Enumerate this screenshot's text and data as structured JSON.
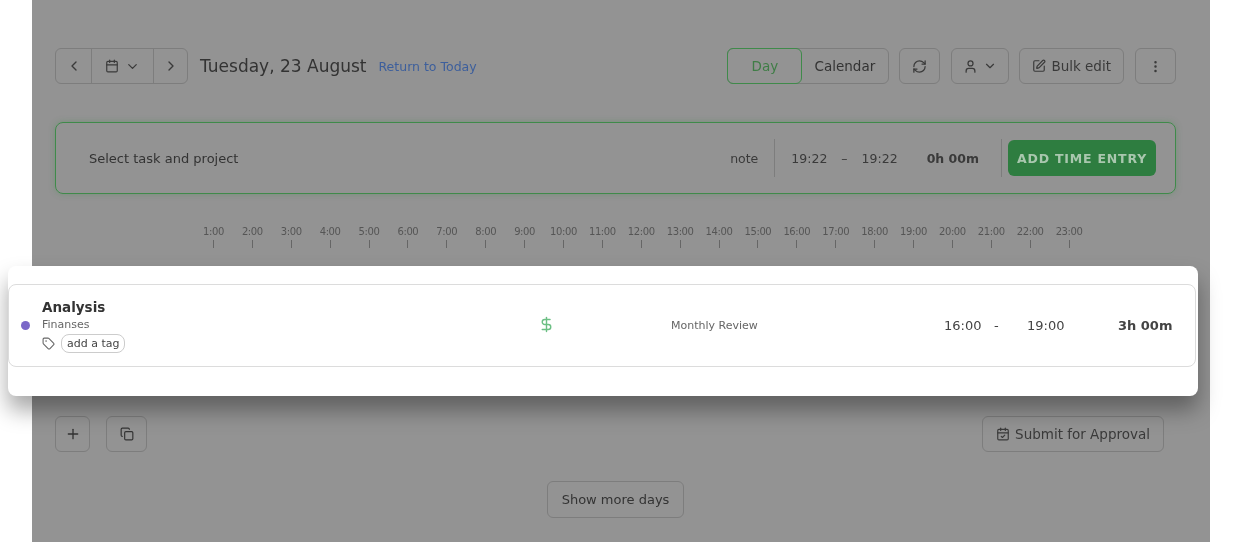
{
  "nav": {
    "date": "Tuesday, 23 August",
    "return_link": "Return to Today"
  },
  "view_tabs": [
    {
      "label": "Day",
      "selected": true
    },
    {
      "label": "Calendar",
      "selected": false
    }
  ],
  "bulk_edit": "Bulk edit",
  "entry_bar": {
    "placeholder": "Select task and project",
    "note": "note",
    "start": "19:22",
    "separator": "–",
    "end": "19:22",
    "duration": "0h 00m",
    "button": "ADD TIME ENTRY"
  },
  "timeline": {
    "hours": [
      "1:00",
      "2:00",
      "3:00",
      "4:00",
      "5:00",
      "6:00",
      "7:00",
      "8:00",
      "9:00",
      "10:00",
      "11:00",
      "12:00",
      "13:00",
      "14:00",
      "15:00",
      "16:00",
      "17:00",
      "18:00",
      "19:00",
      "20:00",
      "21:00",
      "22:00",
      "23:00"
    ]
  },
  "entries": [
    {
      "task": "Analysis",
      "project": "Finanses",
      "color": "#7b68c8",
      "tag_button": "add a tag",
      "billable": true,
      "description": "Monthly Review",
      "start": "16:00",
      "separator": "-",
      "end": "19:00",
      "duration": "3h 00m"
    }
  ],
  "submit": "Submit for Approval",
  "show_more": "Show more days"
}
